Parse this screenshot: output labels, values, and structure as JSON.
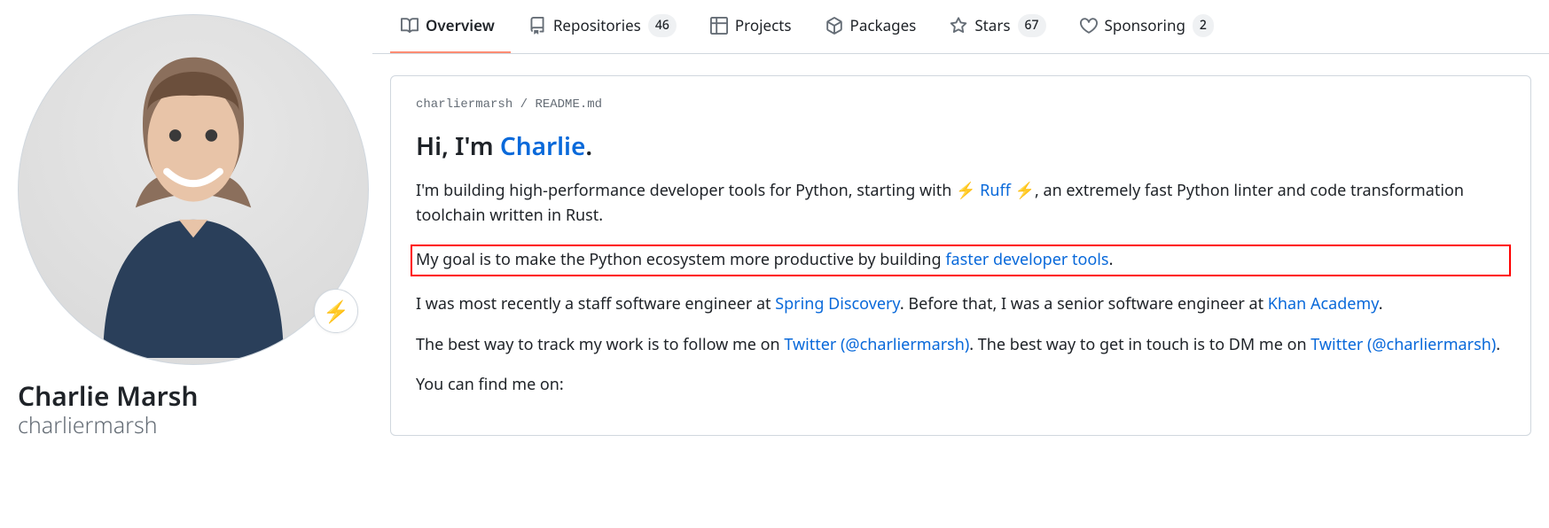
{
  "profile": {
    "fullname": "Charlie Marsh",
    "username": "charliermarsh",
    "status_emoji": "⚡"
  },
  "tabs": {
    "overview": "Overview",
    "repositories": "Repositories",
    "repositories_count": "46",
    "projects": "Projects",
    "packages": "Packages",
    "stars": "Stars",
    "stars_count": "67",
    "sponsoring": "Sponsoring",
    "sponsoring_count": "2"
  },
  "readme": {
    "path_user": "charliermarsh",
    "path_sep": " / ",
    "path_file": "README",
    "path_ext": ".md",
    "h1_pre": "Hi, I'm ",
    "h1_link": "Charlie",
    "h1_post": ".",
    "p1_a": "I'm building high-performance developer tools for Python, starting with ",
    "zap": "⚡",
    "p1_ruff": "Ruff",
    "p1_b": ", an extremely fast Python linter and code transformation toolchain written in Rust.",
    "p2_a": "My goal is to make the Python ecosystem more productive by building ",
    "p2_link": "faster developer tools",
    "p2_b": ".",
    "p3_a": "I was most recently a staff software engineer at ",
    "p3_link1": "Spring Discovery",
    "p3_b": ". Before that, I was a senior software engineer at ",
    "p3_link2": "Khan Academy",
    "p3_c": ".",
    "p4_a": "The best way to track my work is to follow me on ",
    "p4_link1": "Twitter (@charliermarsh)",
    "p4_b": ". The best way to get in touch is to DM me on ",
    "p4_link2": "Twitter (@charliermarsh)",
    "p4_c": ".",
    "p5": "You can find me on:"
  }
}
